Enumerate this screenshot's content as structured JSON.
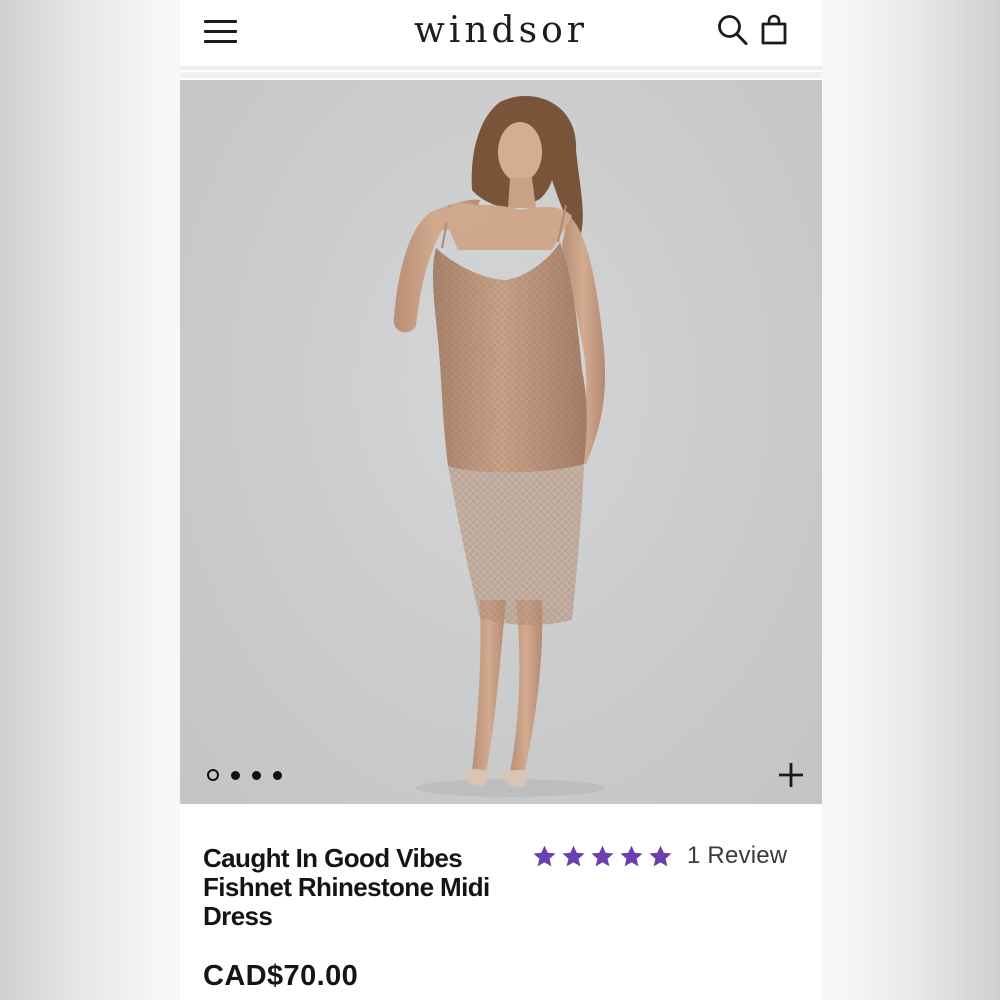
{
  "header": {
    "logo_text": "windsor",
    "menu_icon": "hamburger-menu-icon",
    "search_icon": "search-icon",
    "bag_icon": "shopping-bag-icon"
  },
  "gallery": {
    "image_alt": "Model wearing rose-gold fishnet rhinestone midi dress",
    "image_count": 4,
    "active_index": 0,
    "zoom_icon": "plus-icon"
  },
  "product": {
    "title": "Caught In Good Vibes Fishnet Rhinestone Midi Dress",
    "rating": 5,
    "star_color": "#6a3fae",
    "review_label": "1 Review",
    "price": "CAD$70.00"
  }
}
